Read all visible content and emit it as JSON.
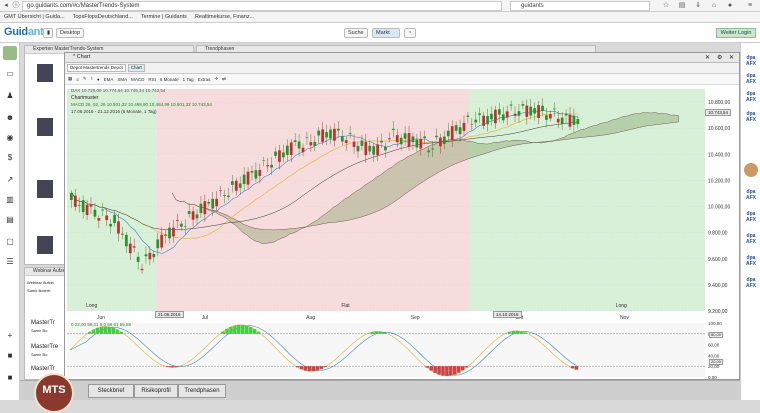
{
  "browser": {
    "url": "go.guidants.com/#c/MasterTrends-System",
    "search_placeholder": "guidants",
    "bookmarks": [
      "GMT Übersicht | Guida...",
      "TopsFlopsDeutschland...",
      "Termine | Guidants",
      "Realtimekurse, Finanz..."
    ]
  },
  "app": {
    "logo_main": "Guid",
    "logo_accent": "ants",
    "btn_desktop": "Desktop",
    "btn_suche": "Suche",
    "btn_markt": "Markt",
    "btn_login": "Weiter Login"
  },
  "panels": {
    "experts_title": "Experten MasterTrends-System",
    "trend_title": "Trendphasen",
    "webinar_title": "Webinar Aufzeichnungen",
    "webinar_tab1": "Webinar Aufzei",
    "webinar_tab2": "Samir Boterb.",
    "mt_label1": "MasterTr",
    "mt_label2": "MasterTre",
    "mt_label3": "Samir Bo",
    "mt_label4": "MasterTr",
    "mt_label5": "Samir Bo"
  },
  "chart_window": {
    "title": "* Chart",
    "tabs": [
      "Depot Mastertrends Depot",
      "Chart"
    ],
    "toolbar": [
      "EMA",
      "SMA",
      "MACD",
      "RSI",
      "6 Monate",
      "1 Tag",
      "Extras"
    ],
    "info_line1": "DAX   10.720,00  10.774,64  10.745,34  10.743,54",
    "info_line2": "Chartmuster",
    "info_line3": "MACD  26,  52,  26  10.501,32  10.468,90  10.484,99  10.501,32  10.743,54",
    "info_line4": "17.06.2016 - 21.12.2016 (6 Monate, 1 Tag)",
    "date_marker1": "21.06.2016",
    "date_marker2": "14.10.2016",
    "last_price": "10.743,54",
    "osc_info": "0  22,00 59,21  5,0  59,61  55,58",
    "osc_level_high": "80,00",
    "osc_level_low": "20,00"
  },
  "bottom_tabs": [
    "Steckbrief",
    "Risikoprofil",
    "Trendphasen"
  ],
  "mts_logo": "MTS",
  "chart_data": {
    "type": "candlestick",
    "x_months": [
      "Jun",
      "Jul",
      "Aug",
      "Sep",
      "Okt",
      "Nov"
    ],
    "x_notes": [
      "Long",
      "Flat",
      "Long"
    ],
    "ylim": [
      9200,
      10900
    ],
    "y_ticks": [
      "10.800,00",
      "10.600,00",
      "10.400,00",
      "10.200,00",
      "10.000,00",
      "9.800,00",
      "9.600,00",
      "9.400,00",
      "9.200,00"
    ],
    "osc_ticks": [
      "100,00",
      "80,00",
      "60,00",
      "40,00",
      "20,00",
      "0,00"
    ],
    "phases": [
      {
        "label": "Long",
        "color": "#d8f0d8",
        "from": 0,
        "to": 0.14
      },
      {
        "label": "Flat",
        "color": "#f6dcdc",
        "from": 0.14,
        "to": 0.63
      },
      {
        "label": "Long",
        "color": "#d8f0d8",
        "from": 0.63,
        "to": 1
      }
    ]
  }
}
